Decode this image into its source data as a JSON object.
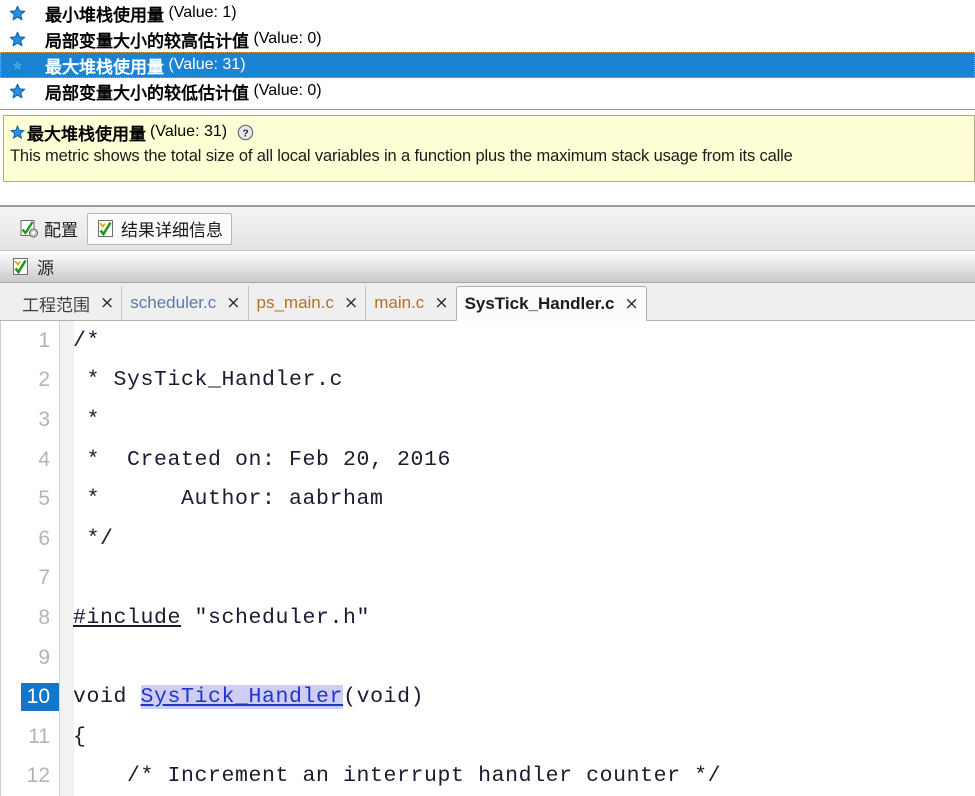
{
  "metric_list": {
    "rows": [
      {
        "icon": "star-icon",
        "label": "最小堆栈使用量",
        "value": "(Value: 1)",
        "selected": false
      },
      {
        "icon": "star-icon",
        "label": "局部变量大小的较高估计值",
        "value": "(Value: 0)",
        "selected": false
      },
      {
        "icon": "star-icon",
        "label": "最大堆栈使用量",
        "value": "(Value: 31)",
        "selected": true
      },
      {
        "icon": "star-icon",
        "label": "局部变量大小的较低估计值",
        "value": "(Value: 0)",
        "selected": false
      }
    ]
  },
  "tooltip": {
    "star_icon": "star-icon",
    "title": "最大堆栈使用量",
    "value": "(Value: 31)",
    "help_icon": "help-icon",
    "body": "This metric shows the total size of all local variables in a function plus the maximum stack usage from its calle"
  },
  "sub_tabs": {
    "items": [
      {
        "icon": "config-icon",
        "label": "配置",
        "active": false
      },
      {
        "icon": "checked-document-icon",
        "label": "结果详细信息",
        "active": true
      }
    ]
  },
  "view_header": {
    "icon": "checked-document-icon",
    "title": "源"
  },
  "file_tabs": {
    "close_glyph": "×",
    "items": [
      {
        "label": "工程范围",
        "active": false,
        "color": "#3f3f3f"
      },
      {
        "label": "scheduler.c",
        "active": false,
        "color": "#5a7ca8"
      },
      {
        "label": "ps_main.c",
        "active": false,
        "color": "#b5702a"
      },
      {
        "label": "main.c",
        "active": false,
        "color": "#b5702a"
      },
      {
        "label": "SysTick_Handler.c",
        "active": true,
        "color": "#1d1d1d"
      }
    ]
  },
  "editor": {
    "current_line": 10,
    "lines": [
      {
        "n": "1",
        "segments": [
          {
            "t": "/*",
            "k": "plain"
          }
        ]
      },
      {
        "n": "2",
        "segments": [
          {
            "t": " * SysTick_Handler.c",
            "k": "plain"
          }
        ]
      },
      {
        "n": "3",
        "segments": [
          {
            "t": " *",
            "k": "plain"
          }
        ]
      },
      {
        "n": "4",
        "segments": [
          {
            "t": " *  Created on: Feb 20, 2016",
            "k": "plain"
          }
        ]
      },
      {
        "n": "5",
        "segments": [
          {
            "t": " *      Author: aabrham",
            "k": "plain"
          }
        ]
      },
      {
        "n": "6",
        "segments": [
          {
            "t": " */",
            "k": "plain"
          }
        ]
      },
      {
        "n": "7",
        "segments": [
          {
            "t": "",
            "k": "plain"
          }
        ]
      },
      {
        "n": "8",
        "segments": [
          {
            "t": "#include",
            "k": "include"
          },
          {
            "t": " \"scheduler.h\"",
            "k": "plain"
          }
        ]
      },
      {
        "n": "9",
        "segments": [
          {
            "t": "",
            "k": "plain"
          }
        ]
      },
      {
        "n": "10",
        "segments": [
          {
            "t": "void ",
            "k": "plain"
          },
          {
            "t": "SysTick_Handler",
            "k": "highlight"
          },
          {
            "t": "(void)",
            "k": "plain"
          }
        ]
      },
      {
        "n": "11",
        "segments": [
          {
            "t": "{",
            "k": "plain"
          }
        ]
      },
      {
        "n": "12",
        "segments": [
          {
            "t": "    /* Increment an interrupt handler counter */",
            "k": "plain"
          }
        ]
      }
    ]
  },
  "colors": {
    "selection_blue": "#1b83d6",
    "tooltip_bg": "#ffffd5",
    "tooltip_border": "#b5ab80",
    "star_blue": "#1b7fd4",
    "current_line_num_bg": "#1276cb",
    "identifier_highlight_bg": "#cfcdf4",
    "identifier_highlight_fg": "#2035cc"
  }
}
